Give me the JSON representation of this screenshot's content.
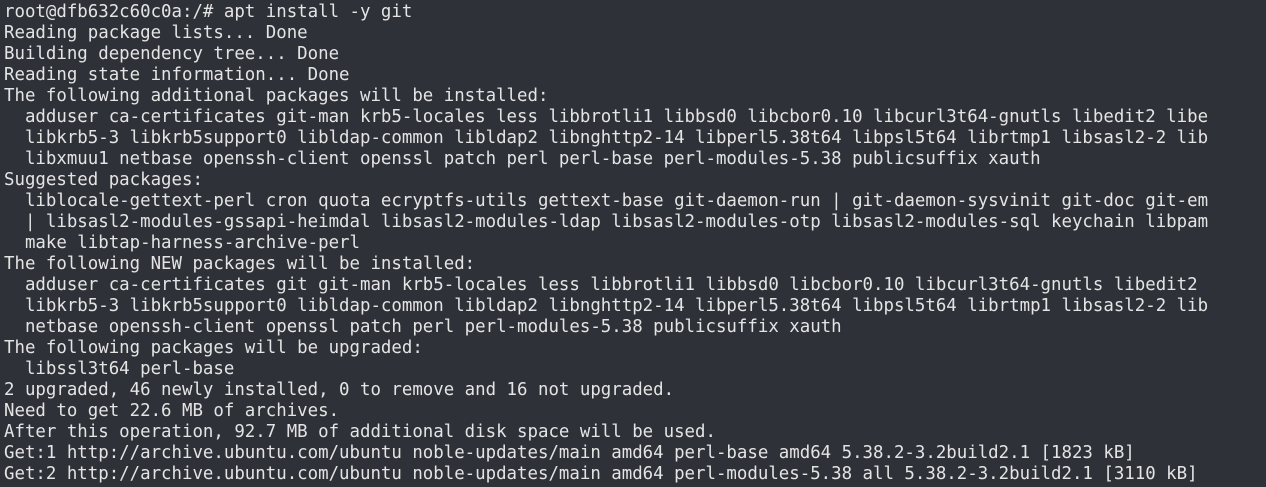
{
  "terminal": {
    "lines": [
      "root@dfb632c60c0a:/# apt install -y git",
      "Reading package lists... Done",
      "Building dependency tree... Done",
      "Reading state information... Done",
      "The following additional packages will be installed:",
      "  adduser ca-certificates git-man krb5-locales less libbrotli1 libbsd0 libcbor0.10 libcurl3t64-gnutls libedit2 libe",
      "  libkrb5-3 libkrb5support0 libldap-common libldap2 libnghttp2-14 libperl5.38t64 libpsl5t64 librtmp1 libsasl2-2 lib",
      "  libxmuu1 netbase openssh-client openssl patch perl perl-base perl-modules-5.38 publicsuffix xauth",
      "Suggested packages:",
      "  liblocale-gettext-perl cron quota ecryptfs-utils gettext-base git-daemon-run | git-daemon-sysvinit git-doc git-em",
      "  | libsasl2-modules-gssapi-heimdal libsasl2-modules-ldap libsasl2-modules-otp libsasl2-modules-sql keychain libpam",
      "  make libtap-harness-archive-perl",
      "The following NEW packages will be installed:",
      "  adduser ca-certificates git git-man krb5-locales less libbrotli1 libbsd0 libcbor0.10 libcurl3t64-gnutls libedit2",
      "  libkrb5-3 libkrb5support0 libldap-common libldap2 libnghttp2-14 libperl5.38t64 libpsl5t64 librtmp1 libsasl2-2 lib",
      "  netbase openssh-client openssl patch perl perl-modules-5.38 publicsuffix xauth",
      "The following packages will be upgraded:",
      "  libssl3t64 perl-base",
      "2 upgraded, 46 newly installed, 0 to remove and 16 not upgraded.",
      "Need to get 22.6 MB of archives.",
      "After this operation, 92.7 MB of additional disk space will be used.",
      "Get:1 http://archive.ubuntu.com/ubuntu noble-updates/main amd64 perl-base amd64 5.38.2-3.2build2.1 [1823 kB]",
      "Get:2 http://archive.ubuntu.com/ubuntu noble-updates/main amd64 perl-modules-5.38 all 5.38.2-3.2build2.1 [3110 kB]"
    ]
  }
}
